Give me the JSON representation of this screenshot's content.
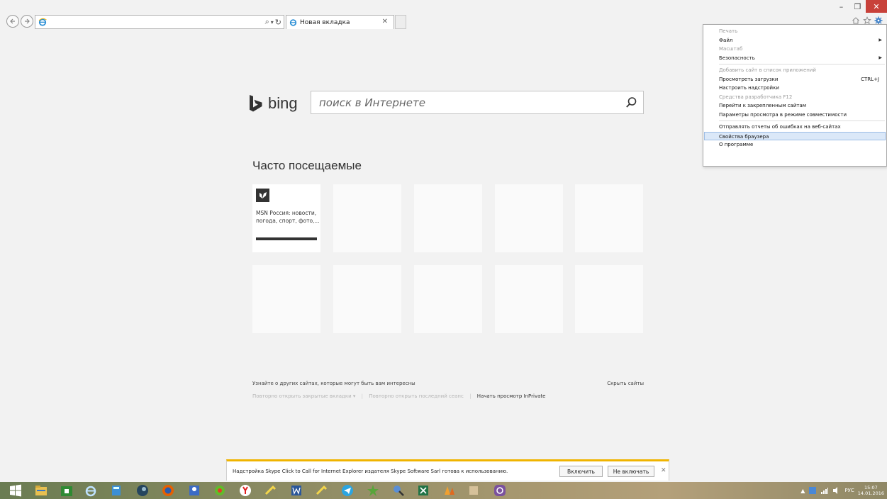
{
  "browser": {
    "tab_title": "Новая вкладка",
    "address_value": "",
    "address_tools": [
      "search",
      "dropdown",
      "refresh"
    ]
  },
  "window_controls": [
    "minimize",
    "restore",
    "close"
  ],
  "toolbar_icons": [
    "home-icon",
    "favorites-star-icon",
    "settings-gear-icon"
  ],
  "search": {
    "brand": "bing",
    "placeholder": "поиск в Интернете"
  },
  "frequent": {
    "title": "Часто посещаемые",
    "tiles": [
      {
        "label": "MSN Россия: новости, погода, спорт, фото,..."
      }
    ]
  },
  "footer": {
    "discover": "Узнайте о других сайтах, которые могут быть вам интересны",
    "hide_sites": "Скрыть сайты",
    "reopen_tabs": "Повторно открыть закрытые вкладки ▾",
    "reopen_session": "Повторно открыть последний сеанс",
    "inprivate": "Начать просмотр InPrivate"
  },
  "tools_menu": {
    "items": [
      {
        "label": "Печать",
        "disabled": true
      },
      {
        "label": "Файл",
        "submenu": true
      },
      {
        "label": "Масштаб",
        "disabled": true
      },
      {
        "label": "Безопасность",
        "submenu": true
      },
      {
        "label": "Добавить сайт в список приложений",
        "disabled": true
      },
      {
        "label": "Просмотреть загрузки",
        "shortcut": "CTRL+J"
      },
      {
        "label": "Настроить надстройки"
      },
      {
        "label": "Средства разработчика F12",
        "disabled": true
      },
      {
        "label": "Перейти к закрепленным сайтам"
      },
      {
        "label": "Параметры просмотра в режиме совместимости"
      },
      {
        "label": "Отправлять отчеты об ошибках на веб-сайтах"
      },
      {
        "label": "Свойства браузера",
        "selected": true
      },
      {
        "label": "О программе"
      }
    ]
  },
  "notification": {
    "text": "Надстройка Skype Click to Call for Internet Explorer издателя Skype Software Sarl готова к использованию.",
    "enable_label": "Включить",
    "disable_label": "Не включать"
  },
  "taskbar": {
    "lang": "РУС",
    "time": "15:07",
    "date": "14.01.2016"
  }
}
